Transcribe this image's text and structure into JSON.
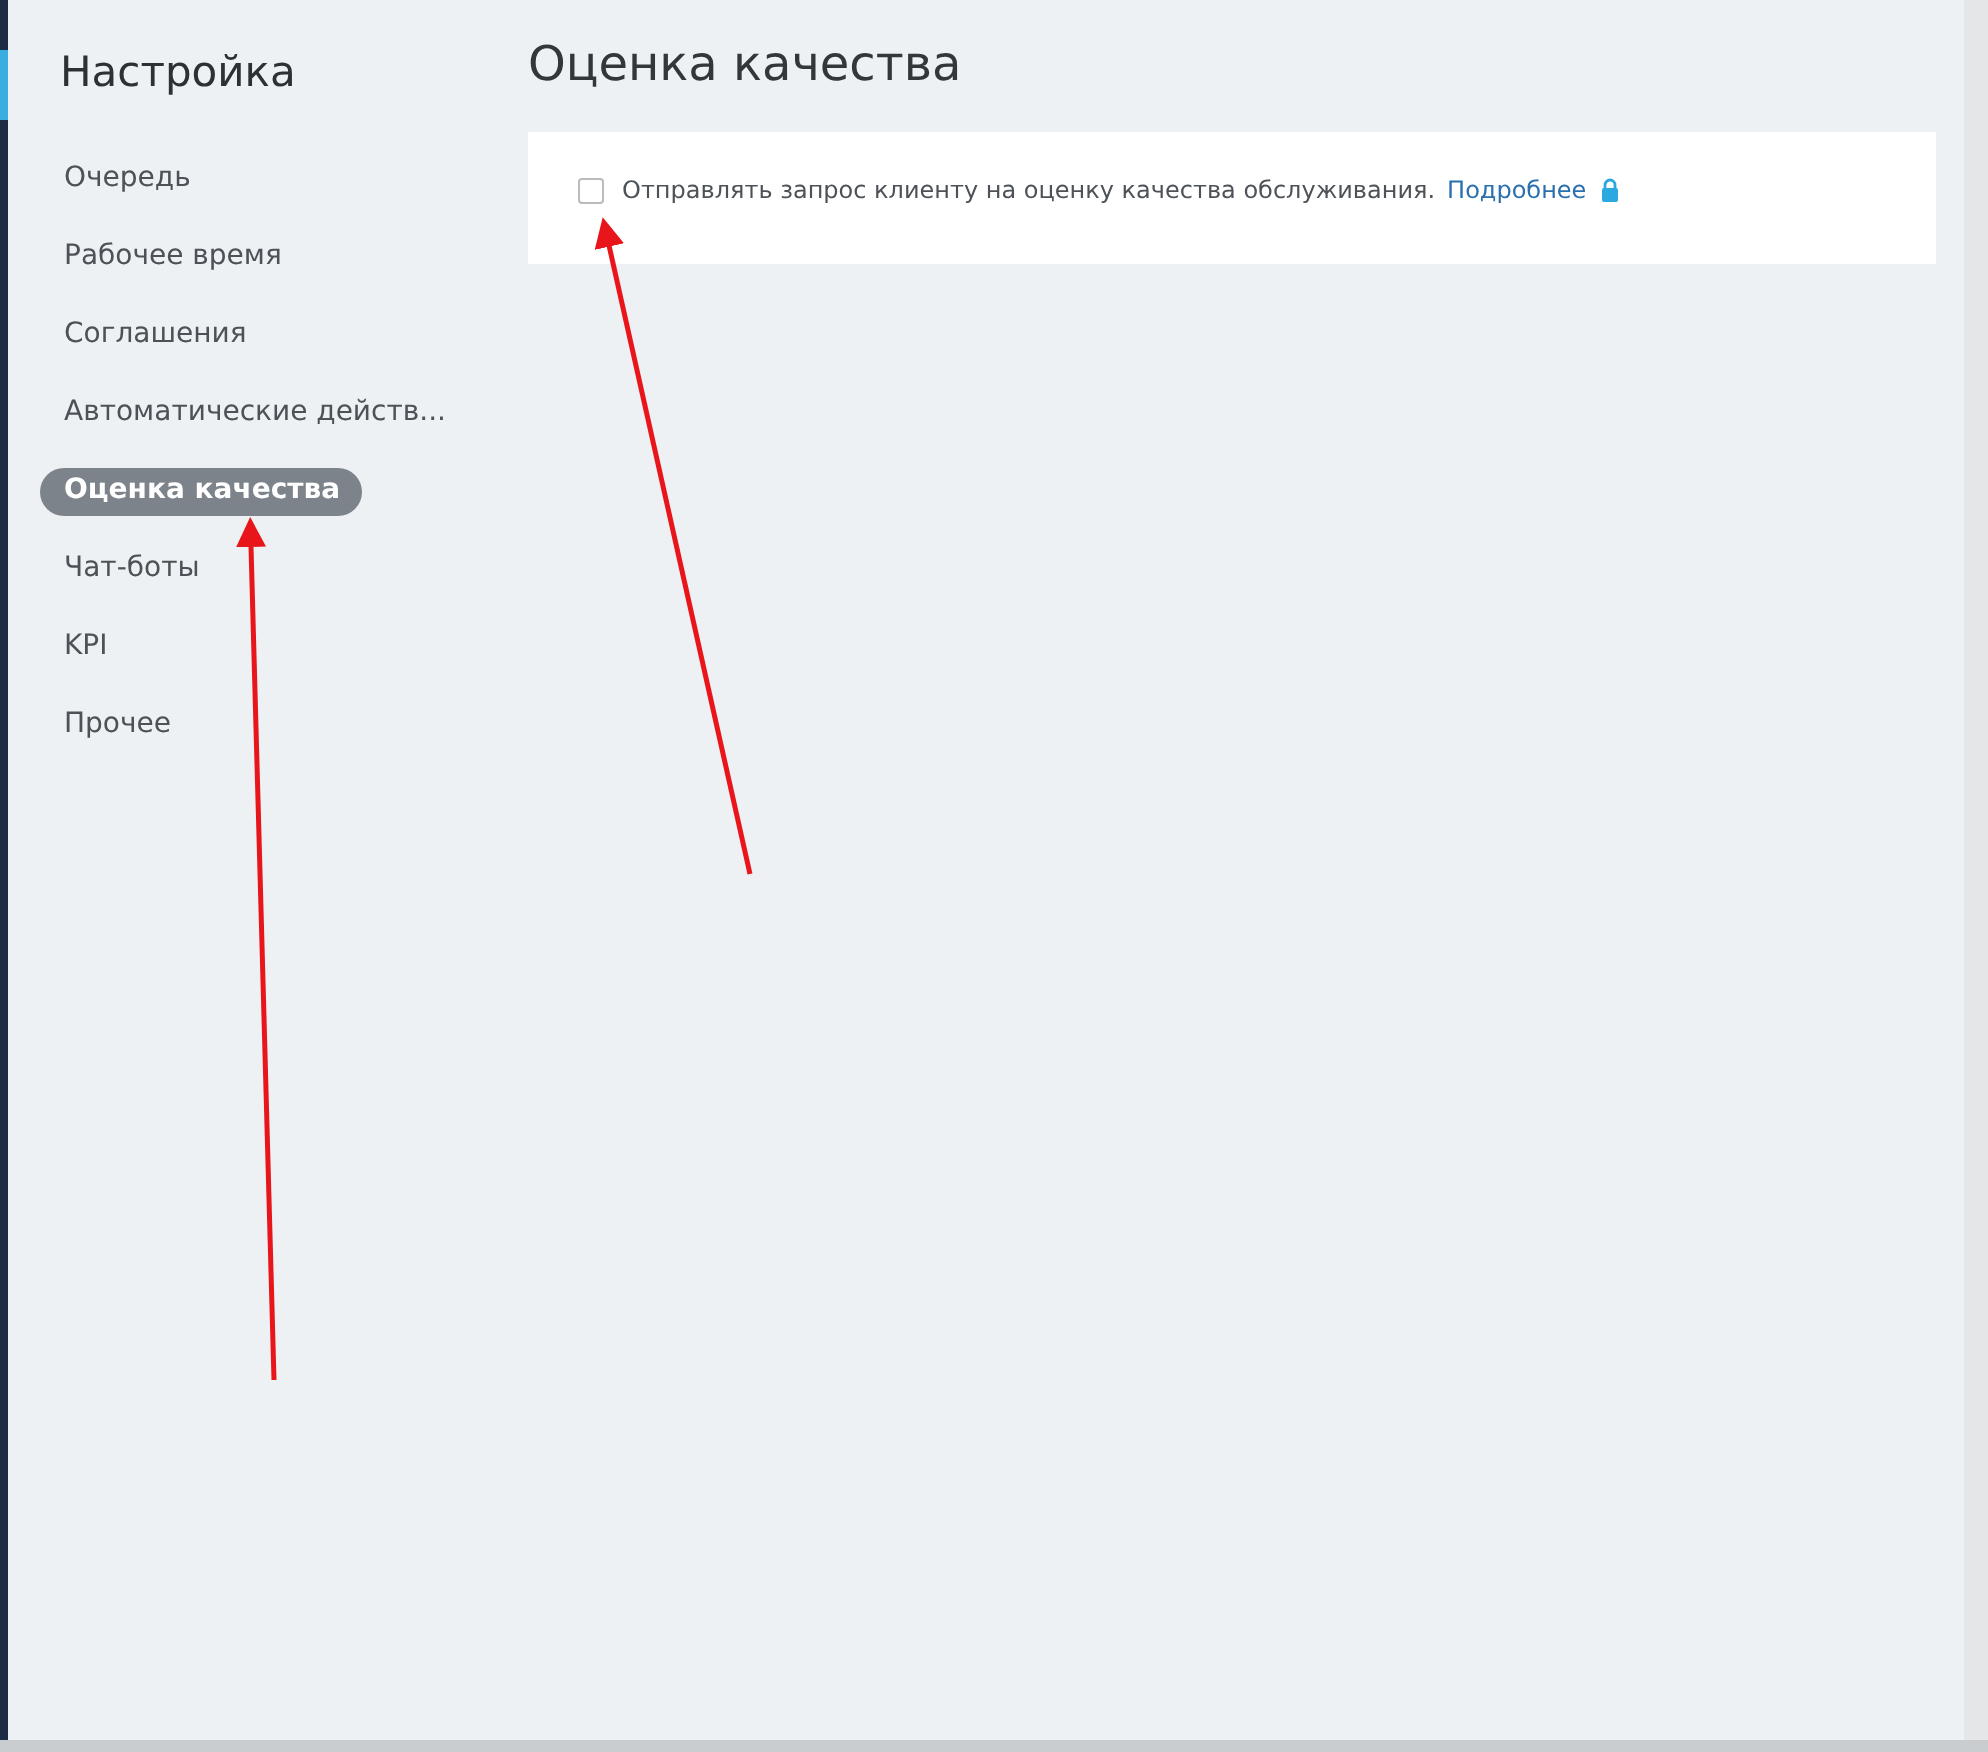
{
  "sidebar": {
    "title": "Настройка",
    "items": [
      {
        "label": "Очередь",
        "selected": false
      },
      {
        "label": "Рабочее время",
        "selected": false
      },
      {
        "label": "Соглашения",
        "selected": false
      },
      {
        "label": "Автоматические действ...",
        "selected": false
      },
      {
        "label": "Оценка качества",
        "selected": true
      },
      {
        "label": "Чат-боты",
        "selected": false
      },
      {
        "label": "KPI",
        "selected": false
      },
      {
        "label": "Прочее",
        "selected": false
      }
    ]
  },
  "main": {
    "title": "Оценка качества",
    "option": {
      "label": "Отправлять запрос клиенту на оценку качества обслуживания.",
      "link": "Подробнее",
      "checked": false,
      "locked": true
    }
  }
}
